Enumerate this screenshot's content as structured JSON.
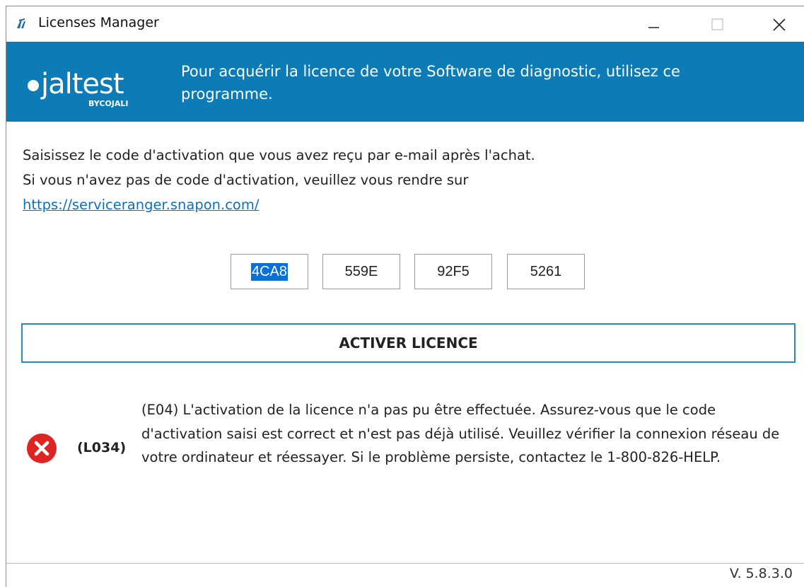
{
  "window": {
    "title": "Licenses Manager"
  },
  "titlebar": {
    "icons": [
      "app-icon",
      "minimize-icon",
      "maximize-icon",
      "close-icon"
    ]
  },
  "header": {
    "logo_text": "jaltest",
    "logo_sub": "BYCOJALI",
    "message": "Pour acquérir la licence de votre Software de diagnostic, utilisez ce programme."
  },
  "intro": {
    "line1": "Saisissez le code d'activation que vous avez reçu par e-mail après l'achat.",
    "line2": "Si vous n'avez pas de code d'activation, veuillez vous rendre sur",
    "link": "https://serviceranger.snapon.com/"
  },
  "activation_code": {
    "fields": [
      "4CA8",
      "559E",
      "92F5",
      "5261"
    ]
  },
  "activate_button": {
    "label": "ACTIVER LICENCE"
  },
  "error": {
    "icon": "error-icon",
    "code": "(L034)",
    "message": "(E04) L'activation de la licence n'a pas pu être effectuée. Assurez-vous que le code d'activation saisi est correct et n'est pas déjà utilisé. Veuillez vérifier la connexion réseau de votre ordinateur et réessayer. Si le problème persiste, contactez le 1-800-826-HELP."
  },
  "footer": {
    "version": "V. 5.8.3.0"
  },
  "colors": {
    "header_bg": "#0d7bb5",
    "link": "#0a70c0",
    "button_border": "#2a86c4",
    "error_red": "#e02424",
    "selection": "#0a6fd6"
  }
}
